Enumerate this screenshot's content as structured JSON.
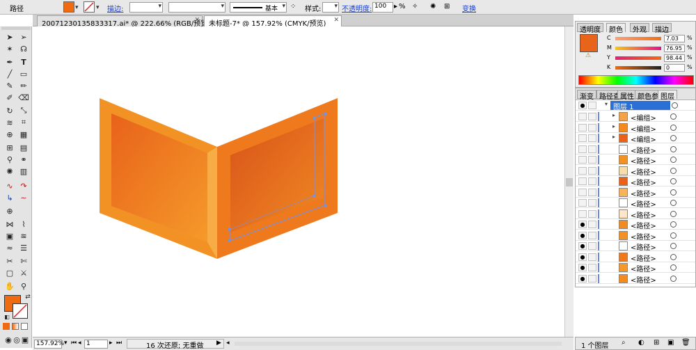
{
  "control_bar": {
    "object_label": "路径",
    "stroke_label": "描边:",
    "stroke_preset": "基本",
    "style_label": "样式:",
    "opacity_label": "不透明度:",
    "opacity_value": "100",
    "opacity_unit": "%",
    "transform_label": "变换",
    "fill_color": "#f06a10"
  },
  "tabs": [
    {
      "label": "20071230135833317.ai* @ 222.66% (RGB/预览)"
    },
    {
      "label": "未标题-7* @ 157.92% (CMYK/预览)"
    }
  ],
  "status": {
    "zoom": "157.92%",
    "page": "1",
    "history": "16 次还原; 无重做"
  },
  "color_panel": {
    "tabs": [
      "透明度",
      "颜色",
      "外观",
      "描边"
    ],
    "active_tab": "颜色",
    "channels": [
      {
        "name": "C",
        "value": "7.03"
      },
      {
        "name": "M",
        "value": "76.95"
      },
      {
        "name": "Y",
        "value": "98.44"
      },
      {
        "name": "K",
        "value": "0"
      }
    ],
    "percent": "%",
    "swatch": "#e8641a"
  },
  "layers_panel": {
    "tabs": [
      "渐变",
      "路径查",
      "属性",
      "颜色参",
      "图层"
    ],
    "active_tab": "图层",
    "layer_name": "图层 1",
    "items": [
      {
        "name": "<编组>",
        "expand": "▸"
      },
      {
        "name": "<编组>",
        "expand": "▸"
      },
      {
        "name": "<编组>",
        "expand": "▸"
      },
      {
        "name": "<路径>",
        "expand": ""
      },
      {
        "name": "<路径>",
        "expand": ""
      },
      {
        "name": "<路径>",
        "expand": ""
      },
      {
        "name": "<路径>",
        "expand": ""
      },
      {
        "name": "<路径>",
        "expand": ""
      },
      {
        "name": "<路径>",
        "expand": ""
      },
      {
        "name": "<路径>",
        "expand": ""
      },
      {
        "name": "<路径>",
        "expand": ""
      },
      {
        "name": "<路径>",
        "expand": ""
      },
      {
        "name": "<路径>",
        "expand": ""
      },
      {
        "name": "<路径>",
        "expand": ""
      },
      {
        "name": "<路径>",
        "expand": ""
      },
      {
        "name": "<路径>",
        "expand": ""
      }
    ],
    "footer": "1 个图层"
  },
  "colors": {
    "accent_orange": "#f38b1f",
    "selection": "#7f8fd6",
    "layer_highlight": "#2a6fd6"
  }
}
